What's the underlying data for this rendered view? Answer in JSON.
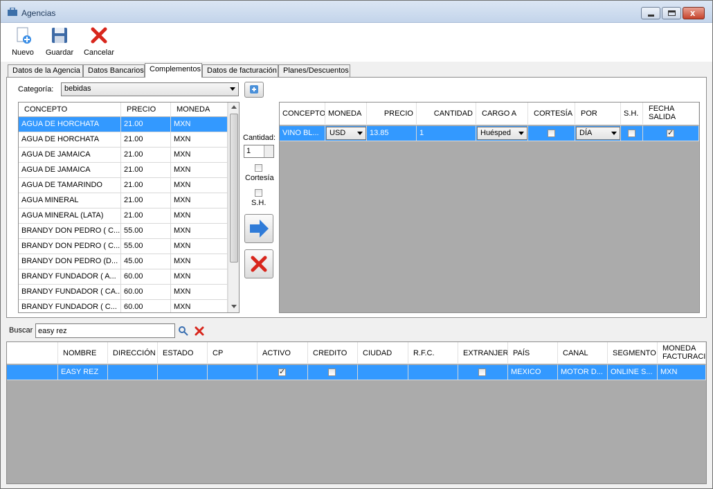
{
  "window": {
    "title": "Agencias"
  },
  "toolbar": {
    "nuevo": "Nuevo",
    "guardar": "Guardar",
    "cancelar": "Cancelar"
  },
  "tabs": [
    "Datos de la Agencia",
    "Datos Bancarios",
    "Complementos",
    "Datos de facturación",
    "Planes/Descuentos"
  ],
  "active_tab": "Complementos",
  "categoria": {
    "label": "Categoría:",
    "value": "bebidas"
  },
  "catalog": {
    "headers": [
      "CONCEPTO",
      "PRECIO",
      "MONEDA"
    ],
    "rows": [
      [
        "AGUA DE HORCHATA",
        "21.00",
        "MXN"
      ],
      [
        "AGUA DE HORCHATA",
        "21.00",
        "MXN"
      ],
      [
        "AGUA DE JAMAICA",
        "21.00",
        "MXN"
      ],
      [
        "AGUA DE JAMAICA",
        "21.00",
        "MXN"
      ],
      [
        "AGUA DE TAMARINDO",
        "21.00",
        "MXN"
      ],
      [
        "AGUA MINERAL",
        "21.00",
        "MXN"
      ],
      [
        "AGUA MINERAL (LATA)",
        "21.00",
        "MXN"
      ],
      [
        "BRANDY DON PEDRO ( C...",
        "55.00",
        "MXN"
      ],
      [
        "BRANDY DON PEDRO ( C...",
        "55.00",
        "MXN"
      ],
      [
        "BRANDY DON PEDRO (D...",
        "45.00",
        "MXN"
      ],
      [
        "BRANDY FUNDADOR ( A...",
        "60.00",
        "MXN"
      ],
      [
        "BRANDY FUNDADOR ( CA...",
        "60.00",
        "MXN"
      ],
      [
        "BRANDY FUNDADOR ( C...",
        "60.00",
        "MXN"
      ]
    ]
  },
  "middle": {
    "cantidad_label": "Cantidad:",
    "cantidad_value": "1",
    "cortesia_label": "Cortesía",
    "sh_label": "S.H."
  },
  "assigned": {
    "headers": [
      "CONCEPTO",
      "MONEDA",
      "PRECIO",
      "CANTIDAD",
      "CARGO A",
      "CORTESÍA",
      "POR",
      "S.H.",
      "FECHA SALIDA"
    ],
    "row": {
      "concepto": "VINO BL...",
      "moneda": "USD",
      "precio": "13.85",
      "cantidad": "1",
      "cargo": "Huésped",
      "cortesia": false,
      "por": "DÍA",
      "sh": false,
      "fecha_salida": true
    }
  },
  "search": {
    "label": "Buscar",
    "value": "easy rez"
  },
  "agencies": {
    "headers": [
      "NOMBRE",
      "DIRECCIÓN",
      "ESTADO",
      "CP",
      "ACTIVO",
      "CREDITO",
      "CIUDAD",
      "R.F.C.",
      "EXTRANJER",
      "PAÍS",
      "CANAL",
      "SEGMENTO",
      "MONEDA FACTURACI"
    ],
    "row": {
      "nombre": "EASY REZ",
      "direccion": "",
      "estado": "",
      "cp": "",
      "activo": true,
      "credito": false,
      "ciudad": "",
      "rfc": "",
      "extranjero": false,
      "pais": "MEXICO",
      "canal": "MOTOR D...",
      "segmento": "ONLINE S...",
      "moneda": "MXN"
    }
  }
}
